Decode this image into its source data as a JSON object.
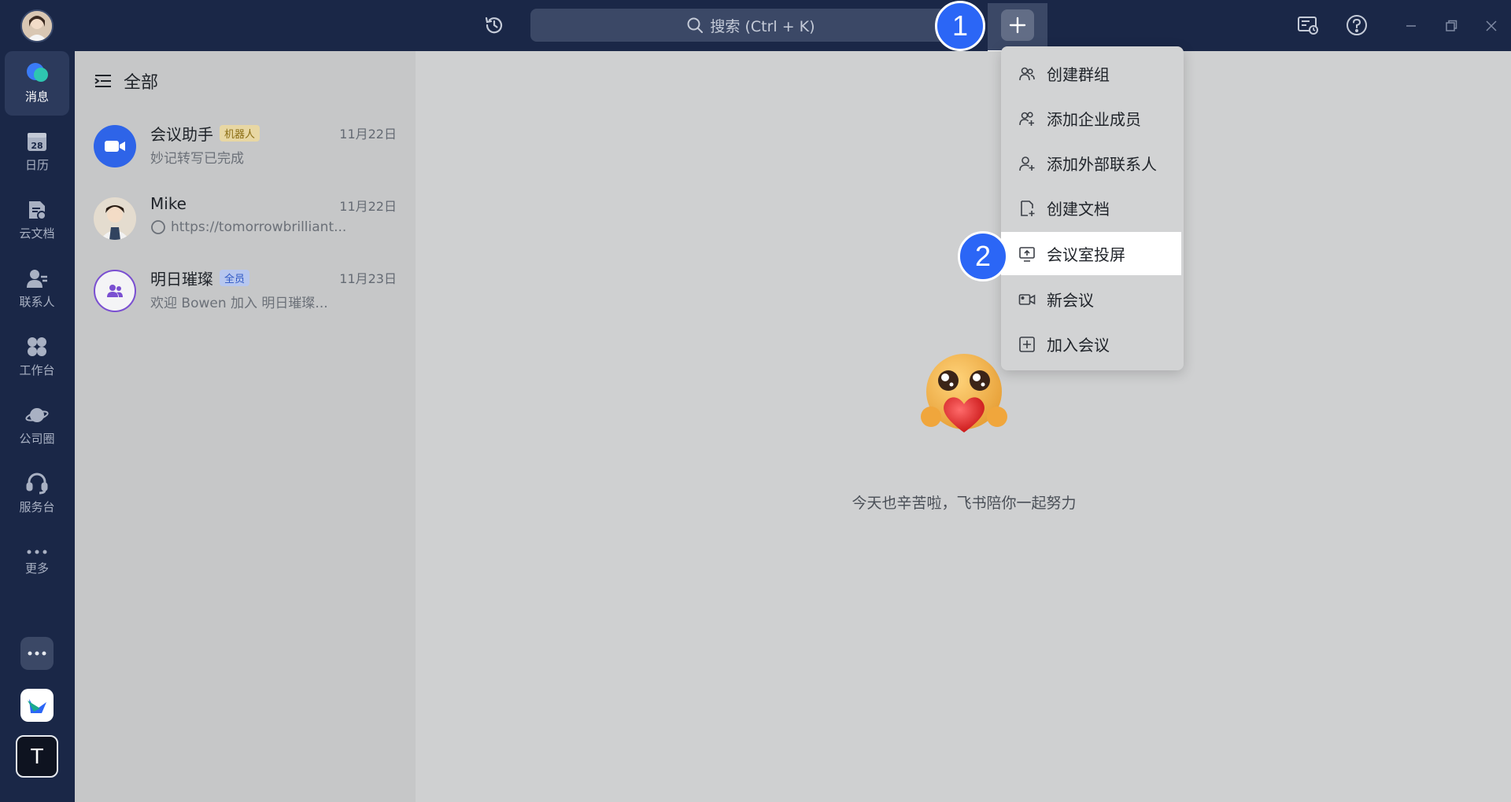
{
  "search": {
    "placeholder": "搜索 (Ctrl + K)"
  },
  "badges": {
    "step1": "1",
    "step2": "2"
  },
  "nav": {
    "items": [
      {
        "label": "消息",
        "icon": "message-icon"
      },
      {
        "label": "日历",
        "icon": "calendar-icon",
        "day": "28"
      },
      {
        "label": "云文档",
        "icon": "docs-icon"
      },
      {
        "label": "联系人",
        "icon": "contacts-icon"
      },
      {
        "label": "工作台",
        "icon": "workplace-icon"
      },
      {
        "label": "公司圈",
        "icon": "planet-icon"
      },
      {
        "label": "服务台",
        "icon": "headset-icon"
      },
      {
        "label": "更多",
        "icon": "more-icon"
      }
    ],
    "bottom_text_avatar": "T"
  },
  "chatlist": {
    "header": "全部",
    "chats": [
      {
        "name": "会议助手",
        "tag": "机器人",
        "time": "11月22日",
        "preview": "妙记转写已完成"
      },
      {
        "name": "Mike",
        "tag": "",
        "time": "11月22日",
        "preview": "https://tomorrowbrilliant..."
      },
      {
        "name": "明日璀璨",
        "tag": "全员",
        "time": "11月23日",
        "preview": "欢迎 Bowen 加入 明日璀璨..."
      }
    ]
  },
  "main": {
    "welcome": "今天也辛苦啦，飞书陪你一起努力"
  },
  "menu": {
    "items": [
      {
        "label": "创建群组",
        "icon": "group-icon"
      },
      {
        "label": "添加企业成员",
        "icon": "add-members-icon"
      },
      {
        "label": "添加外部联系人",
        "icon": "add-contact-icon"
      },
      {
        "label": "创建文档",
        "icon": "new-doc-icon"
      },
      {
        "label": "会议室投屏",
        "icon": "screen-share-icon"
      },
      {
        "label": "新会议",
        "icon": "video-icon"
      },
      {
        "label": "加入会议",
        "icon": "join-meeting-icon"
      }
    ]
  },
  "colors": {
    "topbar": "#1a2747",
    "accent": "#2b66f6",
    "search_bg": "#3b4866"
  }
}
